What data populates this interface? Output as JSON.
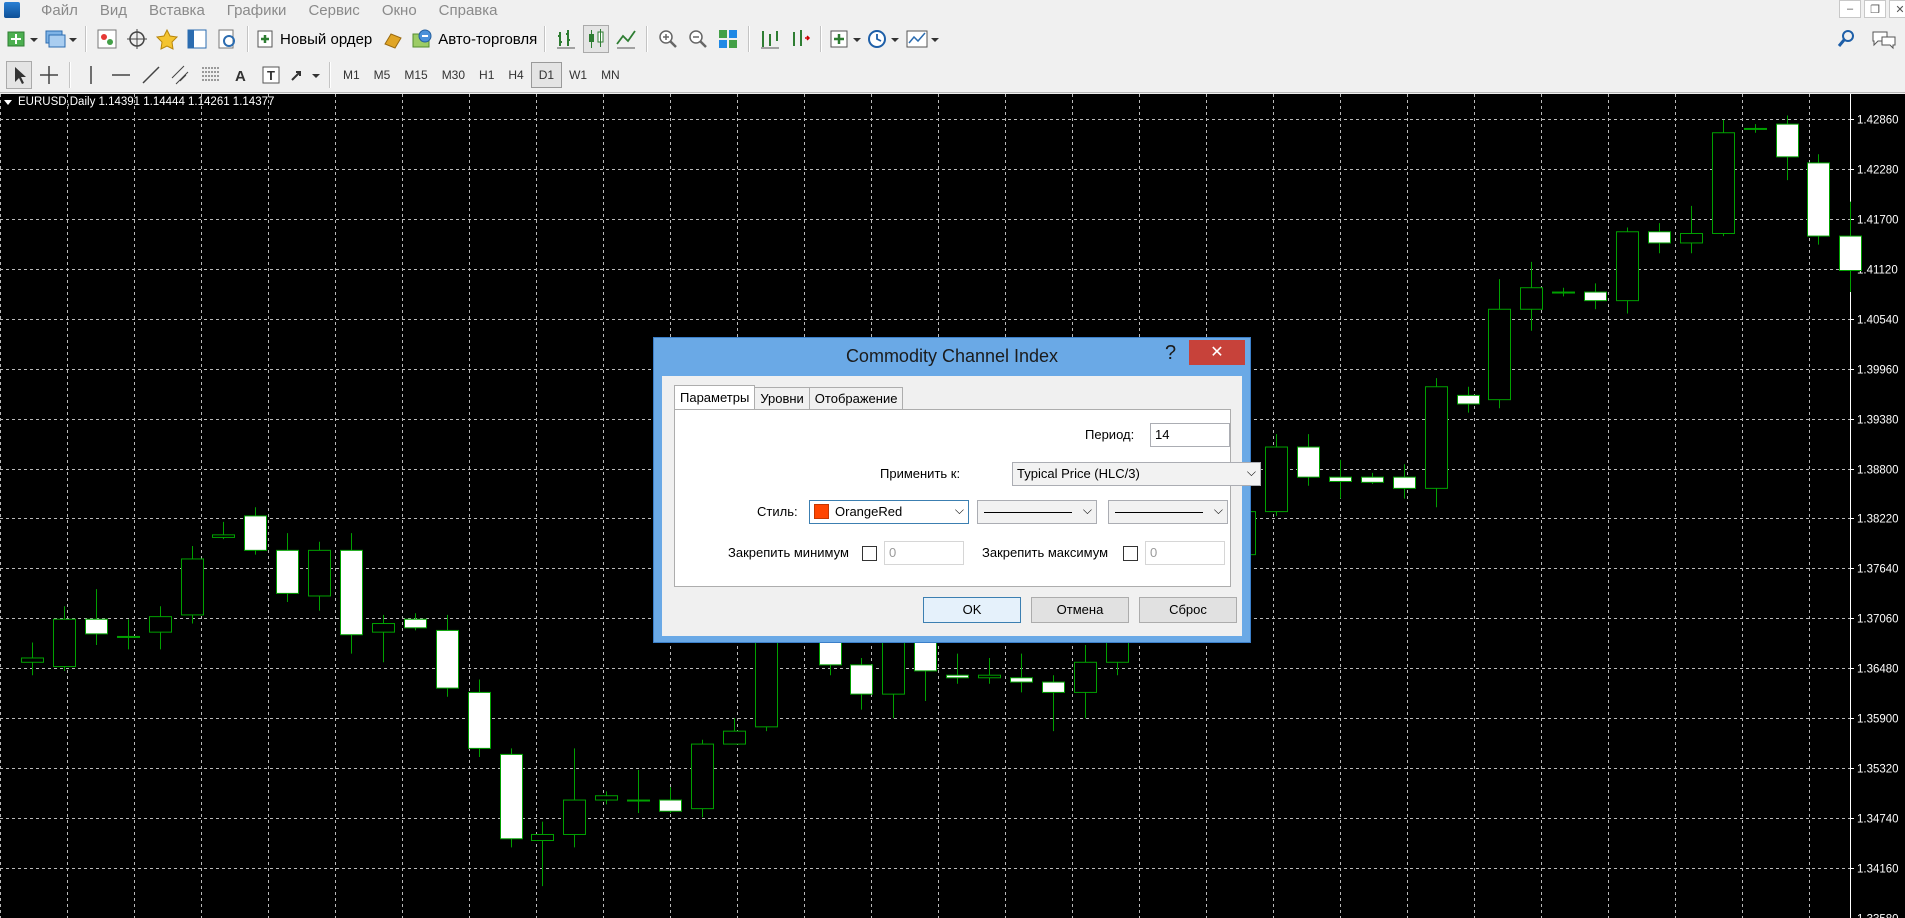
{
  "menu": [
    "Файл",
    "Вид",
    "Вставка",
    "Графики",
    "Сервис",
    "Окно",
    "Справка"
  ],
  "toolbar": {
    "new_order_label": "Новый ордер",
    "autotrading_label": "Авто-торговля"
  },
  "timeframes": [
    "M1",
    "M5",
    "M15",
    "M30",
    "H1",
    "H4",
    "D1",
    "W1",
    "MN"
  ],
  "active_timeframe": "D1",
  "chart": {
    "title": "EURUSD,Daily  1.14391 1.14444 1.14261 1.14377",
    "background": "#000000",
    "candle_up_color": "#00a000",
    "candle_bull_body": "#000000",
    "candle_bear_body": "#ffffff"
  },
  "chart_data": {
    "type": "candlestick",
    "price_axis_labels": [
      "1.42860",
      "1.42280",
      "1.41700",
      "1.41120",
      "1.40540",
      "1.39960",
      "1.39380",
      "1.38800",
      "1.38220",
      "1.37640",
      "1.37060",
      "1.36480",
      "1.35900",
      "1.35320",
      "1.34740",
      "1.34160",
      "1.33580"
    ],
    "ylim": [
      1.3358,
      1.4315
    ],
    "candles": [
      {
        "o": 1.3655,
        "h": 1.3678,
        "l": 1.364,
        "c": 1.366
      },
      {
        "o": 1.365,
        "h": 1.372,
        "l": 1.3645,
        "c": 1.3705
      },
      {
        "o": 1.3705,
        "h": 1.374,
        "l": 1.3675,
        "c": 1.3688
      },
      {
        "o": 1.3685,
        "h": 1.3705,
        "l": 1.367,
        "c": 1.3685
      },
      {
        "o": 1.369,
        "h": 1.372,
        "l": 1.367,
        "c": 1.3708
      },
      {
        "o": 1.371,
        "h": 1.379,
        "l": 1.37,
        "c": 1.3775
      },
      {
        "o": 1.38,
        "h": 1.3818,
        "l": 1.3798,
        "c": 1.3803
      },
      {
        "o": 1.3825,
        "h": 1.3835,
        "l": 1.378,
        "c": 1.3785
      },
      {
        "o": 1.3785,
        "h": 1.3805,
        "l": 1.3725,
        "c": 1.3735
      },
      {
        "o": 1.3732,
        "h": 1.3795,
        "l": 1.3715,
        "c": 1.3785
      },
      {
        "o": 1.3785,
        "h": 1.3805,
        "l": 1.3665,
        "c": 1.3687
      },
      {
        "o": 1.369,
        "h": 1.371,
        "l": 1.3655,
        "c": 1.37
      },
      {
        "o": 1.3705,
        "h": 1.3712,
        "l": 1.3692,
        "c": 1.3695
      },
      {
        "o": 1.3692,
        "h": 1.371,
        "l": 1.3615,
        "c": 1.3625
      },
      {
        "o": 1.362,
        "h": 1.3635,
        "l": 1.3545,
        "c": 1.3555
      },
      {
        "o": 1.3548,
        "h": 1.3555,
        "l": 1.344,
        "c": 1.345
      },
      {
        "o": 1.3448,
        "h": 1.347,
        "l": 1.3395,
        "c": 1.3455
      },
      {
        "o": 1.3455,
        "h": 1.3555,
        "l": 1.344,
        "c": 1.3495
      },
      {
        "o": 1.3495,
        "h": 1.3505,
        "l": 1.349,
        "c": 1.35
      },
      {
        "o": 1.3495,
        "h": 1.353,
        "l": 1.348,
        "c": 1.3495
      },
      {
        "o": 1.3495,
        "h": 1.351,
        "l": 1.348,
        "c": 1.3482
      },
      {
        "o": 1.3485,
        "h": 1.3565,
        "l": 1.3475,
        "c": 1.356
      },
      {
        "o": 1.356,
        "h": 1.359,
        "l": 1.356,
        "c": 1.3575
      },
      {
        "o": 1.358,
        "h": 1.371,
        "l": 1.3575,
        "c": 1.3685
      },
      {
        "o": 1.3685,
        "h": 1.37,
        "l": 1.368,
        "c": 1.3685
      },
      {
        "o": 1.3682,
        "h": 1.3692,
        "l": 1.364,
        "c": 1.3652
      },
      {
        "o": 1.3652,
        "h": 1.366,
        "l": 1.36,
        "c": 1.3618
      },
      {
        "o": 1.3618,
        "h": 1.369,
        "l": 1.359,
        "c": 1.368
      },
      {
        "o": 1.368,
        "h": 1.369,
        "l": 1.361,
        "c": 1.3645
      },
      {
        "o": 1.364,
        "h": 1.3665,
        "l": 1.363,
        "c": 1.3637
      },
      {
        "o": 1.3637,
        "h": 1.366,
        "l": 1.363,
        "c": 1.364
      },
      {
        "o": 1.3637,
        "h": 1.3665,
        "l": 1.362,
        "c": 1.3632
      },
      {
        "o": 1.3632,
        "h": 1.364,
        "l": 1.3575,
        "c": 1.362
      },
      {
        "o": 1.362,
        "h": 1.3675,
        "l": 1.359,
        "c": 1.3655
      },
      {
        "o": 1.3655,
        "h": 1.372,
        "l": 1.364,
        "c": 1.37
      },
      {
        "o": 1.37,
        "h": 1.372,
        "l": 1.368,
        "c": 1.371
      },
      {
        "o": 1.37,
        "h": 1.376,
        "l": 1.369,
        "c": 1.374
      },
      {
        "o": 1.374,
        "h": 1.379,
        "l": 1.373,
        "c": 1.378
      },
      {
        "o": 1.378,
        "h": 1.383,
        "l": 1.377,
        "c": 1.383
      },
      {
        "o": 1.383,
        "h": 1.392,
        "l": 1.3825,
        "c": 1.3905
      },
      {
        "o": 1.3905,
        "h": 1.392,
        "l": 1.386,
        "c": 1.387
      },
      {
        "o": 1.387,
        "h": 1.389,
        "l": 1.3845,
        "c": 1.3865
      },
      {
        "o": 1.387,
        "h": 1.3875,
        "l": 1.3862,
        "c": 1.3864
      },
      {
        "o": 1.387,
        "h": 1.3885,
        "l": 1.3845,
        "c": 1.3857
      },
      {
        "o": 1.3857,
        "h": 1.3985,
        "l": 1.3835,
        "c": 1.3975
      },
      {
        "o": 1.3965,
        "h": 1.3975,
        "l": 1.3945,
        "c": 1.3955
      },
      {
        "o": 1.396,
        "h": 1.41,
        "l": 1.395,
        "c": 1.4065
      },
      {
        "o": 1.4065,
        "h": 1.412,
        "l": 1.404,
        "c": 1.409
      },
      {
        "o": 1.4085,
        "h": 1.409,
        "l": 1.408,
        "c": 1.4085
      },
      {
        "o": 1.4085,
        "h": 1.4095,
        "l": 1.4065,
        "c": 1.4075
      },
      {
        "o": 1.4075,
        "h": 1.416,
        "l": 1.406,
        "c": 1.4155
      },
      {
        "o": 1.4155,
        "h": 1.4165,
        "l": 1.413,
        "c": 1.4142
      },
      {
        "o": 1.4142,
        "h": 1.4185,
        "l": 1.413,
        "c": 1.4153
      },
      {
        "o": 1.4153,
        "h": 1.4285,
        "l": 1.415,
        "c": 1.427
      },
      {
        "o": 1.4275,
        "h": 1.428,
        "l": 1.427,
        "c": 1.4275
      },
      {
        "o": 1.428,
        "h": 1.429,
        "l": 1.4215,
        "c": 1.4242
      },
      {
        "o": 1.4235,
        "h": 1.4245,
        "l": 1.414,
        "c": 1.415
      },
      {
        "o": 1.415,
        "h": 1.419,
        "l": 1.4085,
        "c": 1.411
      }
    ]
  },
  "dialog": {
    "title": "Commodity Channel Index",
    "help": "?",
    "close": "✕",
    "tabs": [
      "Параметры",
      "Уровни",
      "Отображение"
    ],
    "period_label": "Период:",
    "period_value": "14",
    "apply_label": "Применить к:",
    "apply_value": "Typical Price (HLC/3)",
    "style_label": "Стиль:",
    "color_name": "OrangeRed",
    "color_hex": "#ff4500",
    "fix_min_label": "Закрепить минимум",
    "fix_min_value": "0",
    "fix_max_label": "Закрепить максимум",
    "fix_max_value": "0",
    "ok": "OK",
    "cancel": "Отмена",
    "reset": "Сброс"
  }
}
